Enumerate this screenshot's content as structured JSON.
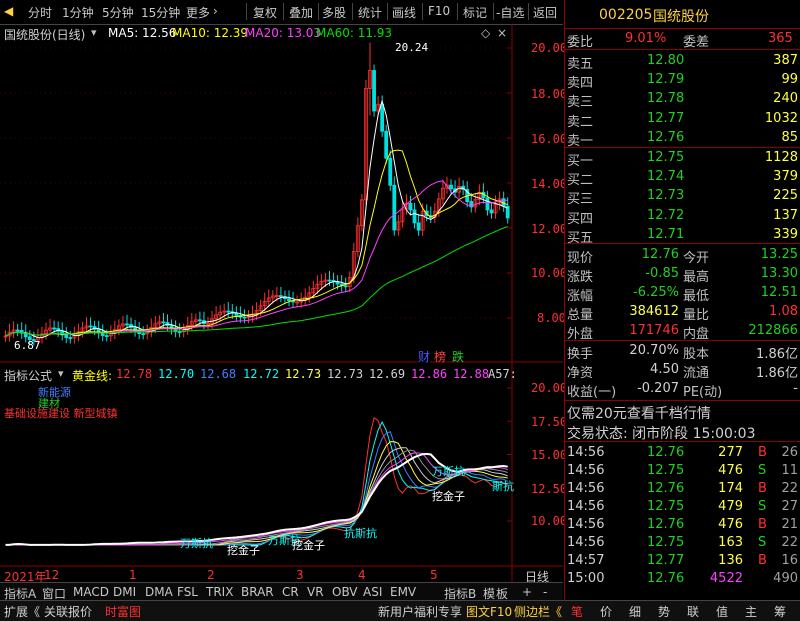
{
  "toolbar": {
    "left_arrow": "◀",
    "items": [
      "分时",
      "1分钟",
      "5分钟",
      "15分钟",
      "更多",
      "复权",
      "叠加",
      "多股",
      "统计",
      "画线",
      "F10",
      "标记",
      "-自选",
      "返回"
    ],
    "more_arrow": "›"
  },
  "main_chart": {
    "title": "国统股份(日线)",
    "ma": [
      {
        "label": "MA5: 12.56",
        "color": "#ffffff"
      },
      {
        "label": "MA10: 12.39",
        "color": "#ffff00"
      },
      {
        "label": "MA20: 13.03",
        "color": "#ff40ff"
      },
      {
        "label": "MA60: 11.93",
        "color": "#00e000"
      }
    ],
    "y_ticks": [
      "20.00",
      "18.00",
      "16.00",
      "14.00",
      "12.00",
      "10.00",
      "8.00"
    ],
    "high_label": "20.24",
    "low_label": "6.87",
    "badges": [
      {
        "text": "财",
        "color": "#5050ff"
      },
      {
        "text": "榜",
        "color": "#ff4040"
      },
      {
        "text": "跌",
        "color": "#20d020"
      }
    ]
  },
  "indicator": {
    "title": "指标公式",
    "line_label": "黄金线:",
    "values": [
      {
        "text": "12.78",
        "color": "#ff3030"
      },
      {
        "text": "12.70",
        "color": "#00ffff"
      },
      {
        "text": "12.68",
        "color": "#4080ff"
      },
      {
        "text": "12.72",
        "color": "#00ffff"
      },
      {
        "text": "12.73",
        "color": "#ffff40"
      },
      {
        "text": "12.73",
        "color": "#d0d0d0"
      },
      {
        "text": "12.69",
        "color": "#d0d0d0"
      },
      {
        "text": "12.86",
        "color": "#ff40ff"
      },
      {
        "text": "12.88",
        "color": "#ff40ff"
      }
    ],
    "extra": "A57:",
    "y_ticks": [
      "20.00",
      "17.50",
      "15.00",
      "12.50",
      "10.00"
    ],
    "legend": [
      {
        "text": "新能源",
        "color": "#4080ff"
      },
      {
        "text": "建材",
        "color": "#20d020"
      },
      {
        "text": "基础设施建设 新型城镇",
        "color": "#ff3030"
      }
    ],
    "tags": [
      {
        "text": "万斯抗",
        "color": "#00ffff"
      },
      {
        "text": "挖金子",
        "color": "#ffffff"
      },
      {
        "text": "万斯抗",
        "color": "#00ffff"
      },
      {
        "text": "挖金子",
        "color": "#ffffff"
      },
      {
        "text": "抗斯抗",
        "color": "#00ffff"
      },
      {
        "text": "万斯抗",
        "color": "#00ffff"
      },
      {
        "text": "挖金子",
        "color": "#ffffff"
      },
      {
        "text": "斯抗",
        "color": "#00ffff"
      }
    ]
  },
  "x_axis": {
    "labels": [
      "2021年",
      "12",
      "1",
      "2",
      "3",
      "4",
      "5"
    ],
    "period": "日线"
  },
  "tabs": [
    "指标A",
    "窗口",
    "MACD",
    "DMI",
    "DMA",
    "FSL",
    "TRIX",
    "BRAR",
    "CR",
    "VR",
    "OBV",
    "ASI",
    "EMV",
    "指标B",
    "模",
    "板",
    "+",
    "-"
  ],
  "quote": {
    "code": "002205",
    "name": "国统股份",
    "weibi": {
      "label": "委比",
      "value": "9.01%",
      "label2": "委差",
      "value2": "365"
    },
    "asks": [
      {
        "label": "卖五",
        "price": "12.80",
        "vol": "387"
      },
      {
        "label": "卖四",
        "price": "12.79",
        "vol": "99"
      },
      {
        "label": "卖三",
        "price": "12.78",
        "vol": "240"
      },
      {
        "label": "卖二",
        "price": "12.77",
        "vol": "1032"
      },
      {
        "label": "卖一",
        "price": "12.76",
        "vol": "85"
      }
    ],
    "bids": [
      {
        "label": "买一",
        "price": "12.75",
        "vol": "1128"
      },
      {
        "label": "买二",
        "price": "12.74",
        "vol": "379"
      },
      {
        "label": "买三",
        "price": "12.73",
        "vol": "225"
      },
      {
        "label": "买四",
        "price": "12.72",
        "vol": "137"
      },
      {
        "label": "买五",
        "price": "12.71",
        "vol": "339"
      }
    ],
    "stats": [
      {
        "l1": "现价",
        "v1": "12.76",
        "c1": "#20d020",
        "l2": "今开",
        "v2": "13.25",
        "c2": "#20d020"
      },
      {
        "l1": "涨跌",
        "v1": "-0.85",
        "c1": "#20d020",
        "l2": "最高",
        "v2": "13.30",
        "c2": "#20d020"
      },
      {
        "l1": "涨幅",
        "v1": "-6.25%",
        "c1": "#20d020",
        "l2": "最低",
        "v2": "12.51",
        "c2": "#20d020"
      },
      {
        "l1": "总量",
        "v1": "384612",
        "c1": "#ffff40",
        "l2": "量比",
        "v2": "1.08",
        "c2": "#ff3030"
      },
      {
        "l1": "外盘",
        "v1": "171746",
        "c1": "#ff3030",
        "l2": "内盘",
        "v2": "212866",
        "c2": "#20d020"
      }
    ],
    "stats2": [
      {
        "l1": "换手",
        "v1": "20.70%",
        "l2": "股本",
        "v2": "1.86亿"
      },
      {
        "l1": "净资",
        "v1": "4.50",
        "l2": "流通",
        "v2": "1.86亿"
      },
      {
        "l1": "收益(一)",
        "v1": "-0.207",
        "l2": "PE(动)",
        "v2": "-"
      }
    ],
    "promo": "仅需20元查看千档行情",
    "status": "交易状态: 闭市阶段 15:00:03",
    "ticks": [
      {
        "time": "14:56",
        "price": "12.76",
        "vol": "277",
        "side": "B",
        "n": "26"
      },
      {
        "time": "14:56",
        "price": "12.75",
        "vol": "476",
        "side": "S",
        "n": "11"
      },
      {
        "time": "14:56",
        "price": "12.76",
        "vol": "174",
        "side": "B",
        "n": "22"
      },
      {
        "time": "14:56",
        "price": "12.75",
        "vol": "479",
        "side": "S",
        "n": "27"
      },
      {
        "time": "14:56",
        "price": "12.76",
        "vol": "476",
        "side": "B",
        "n": "21"
      },
      {
        "time": "14:56",
        "price": "12.75",
        "vol": "163",
        "side": "S",
        "n": "22"
      },
      {
        "time": "14:57",
        "price": "12.77",
        "vol": "136",
        "side": "B",
        "n": "16"
      },
      {
        "time": "15:00",
        "price": "12.76",
        "vol": "4522",
        "side": "",
        "n": "490"
      }
    ]
  },
  "bottom": {
    "left": [
      "扩展《",
      "关联报价",
      "时富图"
    ],
    "mid": [
      "新用户福利专享",
      "图文F10",
      "侧边栏《"
    ],
    "right": [
      "笔",
      "价",
      "细",
      "势",
      "联",
      "值",
      "主",
      "筹"
    ]
  }
}
